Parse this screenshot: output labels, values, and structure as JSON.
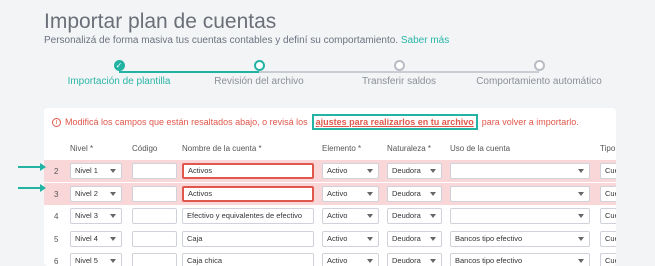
{
  "header": {
    "title": "Importar plan de cuentas",
    "subtitle": "Personalizá de forma masiva tus cuentas contables y definí su comportamiento.",
    "subtitle_link": "Saber más"
  },
  "stepper": {
    "steps": [
      {
        "label": "Importación de plantilla",
        "state": "done"
      },
      {
        "label": "Revisión del archivo",
        "state": "active"
      },
      {
        "label": "Transferir saldos",
        "state": "pending"
      },
      {
        "label": "Comportamiento automático",
        "state": "pending"
      }
    ],
    "colors": {
      "accent": "#22b3a3",
      "pending": "#b9bcc4"
    }
  },
  "alert": {
    "prefix": "Modificá los campos que están resaltados abajo, o revisá los",
    "link": "ajustes para realizarlos en tu archivo",
    "suffix": "para volver a importarlo."
  },
  "table": {
    "headers": {
      "nivel": "Nivel *",
      "codigo": "Código",
      "nombre": "Nombre de la cuenta *",
      "elemento": "Elemento *",
      "naturaleza": "Naturaleza *",
      "uso": "Uso de la cuenta",
      "tipo": "Tipo"
    },
    "rows": [
      {
        "num": "2",
        "nivel": "Nivel 1",
        "codigo": "",
        "nombre": "Activos",
        "elemento": "Activo",
        "naturaleza": "Deudora",
        "uso": "",
        "tipo": "Cue",
        "error": true
      },
      {
        "num": "3",
        "nivel": "Nivel 2",
        "codigo": "",
        "nombre": "Activos",
        "elemento": "Activo",
        "naturaleza": "Deudora",
        "uso": "",
        "tipo": "Cue",
        "error": true
      },
      {
        "num": "4",
        "nivel": "Nivel 3",
        "codigo": "",
        "nombre": "Efectivo y equivalentes de efectivo",
        "elemento": "Activo",
        "naturaleza": "Deudora",
        "uso": "",
        "tipo": "Cue",
        "error": false
      },
      {
        "num": "5",
        "nivel": "Nivel 4",
        "codigo": "",
        "nombre": "Caja",
        "elemento": "Activo",
        "naturaleza": "Deudora",
        "uso": "Bancos tipo efectivo",
        "tipo": "Cue",
        "error": false
      },
      {
        "num": "6",
        "nivel": "Nivel 5",
        "codigo": "",
        "nombre": "Caja chica",
        "elemento": "Activo",
        "naturaleza": "Deudora",
        "uso": "Bancos tipo efectivo",
        "tipo": "Cue",
        "error": false
      }
    ]
  }
}
